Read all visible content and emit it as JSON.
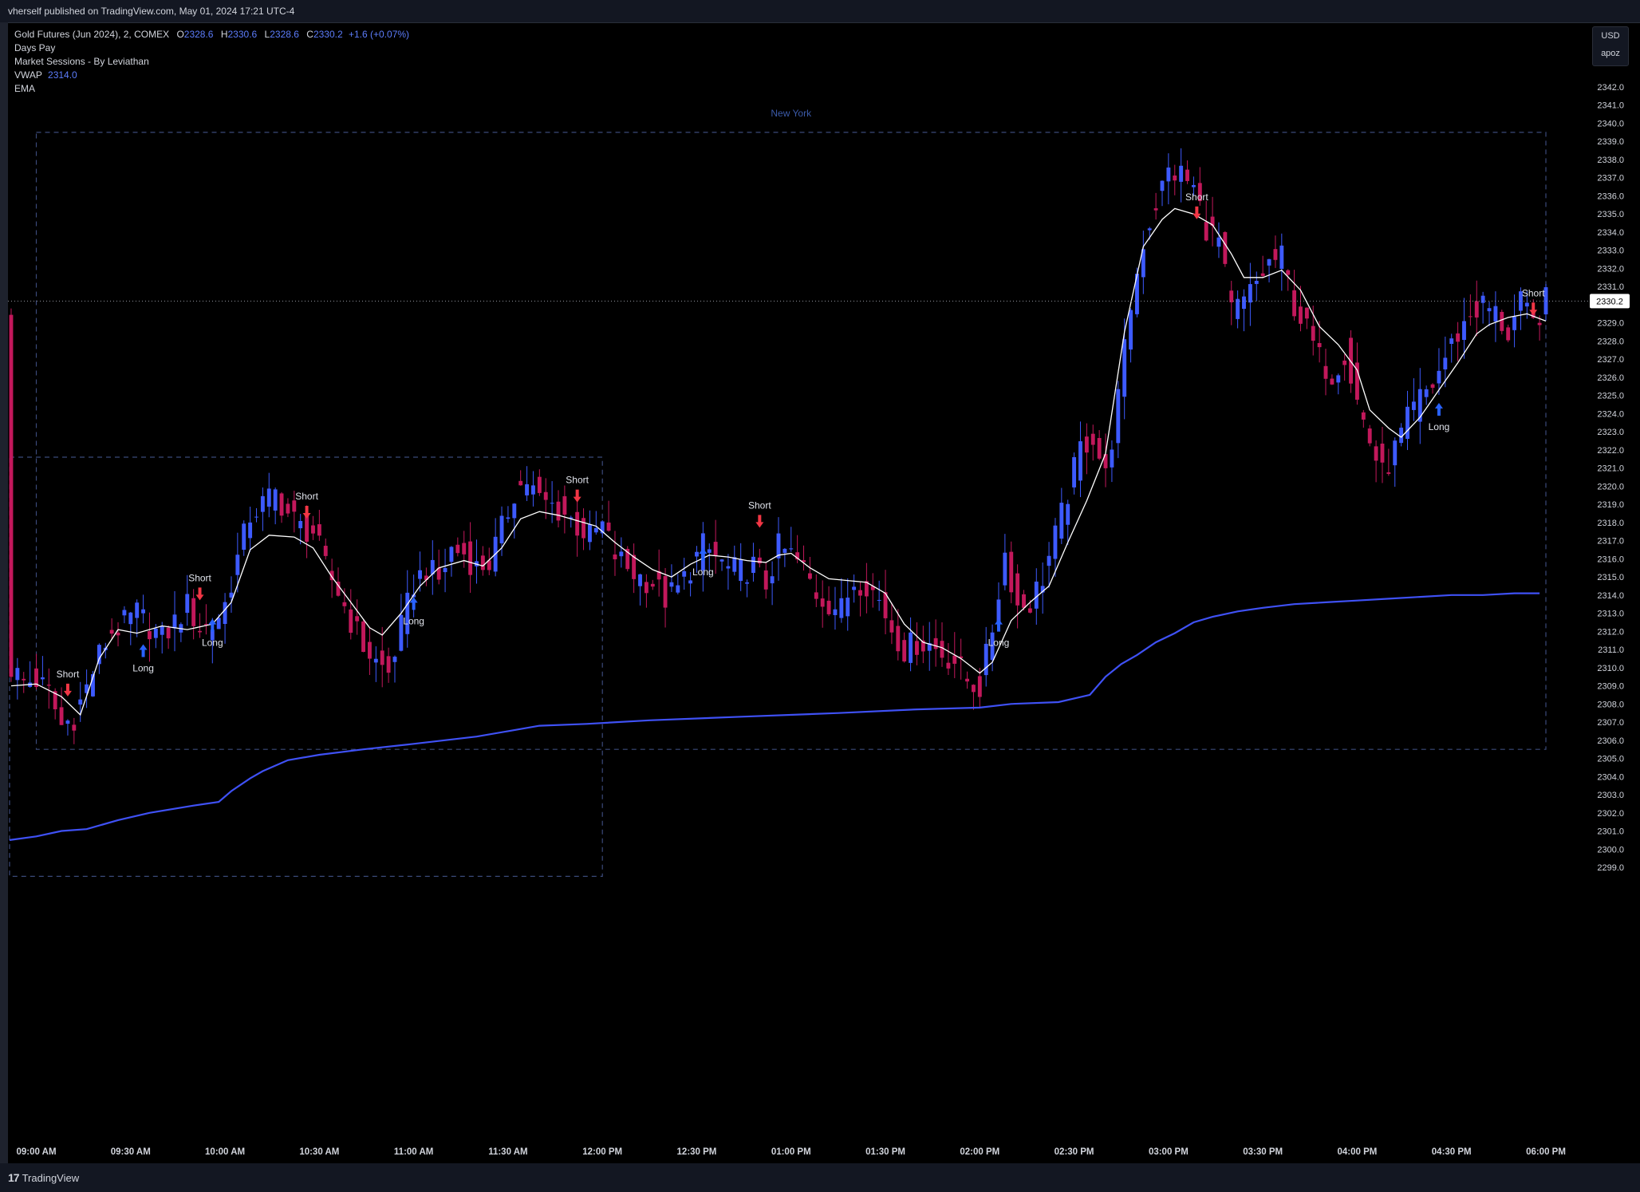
{
  "header": {
    "publish_note": "vherself published on TradingView.com, May 01, 2024 17:21 UTC-4"
  },
  "legend": {
    "symbol": "Gold Futures (Jun 2024), 2, COMEX",
    "open_label": "O",
    "open": "2328.6",
    "high_label": "H",
    "high": "2330.6",
    "low_label": "L",
    "low": "2328.6",
    "close_label": "C",
    "close": "2330.2",
    "change": "+1.6 (+0.07%)",
    "indicators": [
      {
        "name": "Days Pay",
        "value": ""
      },
      {
        "name": "Market Sessions - By Leviathan",
        "value": ""
      },
      {
        "name": "VWAP",
        "value": "2314.0"
      },
      {
        "name": "EMA",
        "value": ""
      }
    ]
  },
  "currency": {
    "code": "USD",
    "unit": "apoz"
  },
  "footer": {
    "brand": "TradingView",
    "brand_mark": "17"
  },
  "colors": {
    "background": "#000000",
    "up_candle": "#3d5afe",
    "down_candle": "#c2185b",
    "vwap": "#3f51f5",
    "ema": "#ffffff",
    "session_box": "#3b4a7a",
    "long_arrow": "#2962ff",
    "short_arrow": "#f23645",
    "axis_text": "#d1d4dc"
  },
  "chart_data": {
    "type": "candlestick",
    "symbol": "Gold Futures (Jun 2024), 2, COMEX",
    "ylim": [
      2298.5,
      2342.8
    ],
    "y_ticks": [
      2299.0,
      2300.0,
      2301.0,
      2302.0,
      2303.0,
      2304.0,
      2305.0,
      2306.0,
      2307.0,
      2308.0,
      2309.0,
      2310.0,
      2311.0,
      2312.0,
      2313.0,
      2314.0,
      2315.0,
      2316.0,
      2317.0,
      2318.0,
      2319.0,
      2320.0,
      2321.0,
      2322.0,
      2323.0,
      2324.0,
      2325.0,
      2326.0,
      2327.0,
      2328.0,
      2329.0,
      2330.0,
      2331.0,
      2332.0,
      2333.0,
      2334.0,
      2335.0,
      2336.0,
      2337.0,
      2338.0,
      2339.0,
      2340.0,
      2341.0,
      2342.0
    ],
    "y_tick_labels": [
      "2299.0",
      "2300.0",
      "2301.0",
      "2302.0",
      "2303.0",
      "2304.0",
      "2305.0",
      "2306.0",
      "2307.0",
      "2308.0",
      "2309.0",
      "2310.0",
      "2311.0",
      "2312.0",
      "2313.0",
      "2314.0",
      "2315.0",
      "2316.0",
      "2317.0",
      "2318.0",
      "2319.0",
      "2320.0",
      "2321.0",
      "2322.0",
      "2323.0",
      "2324.0",
      "2325.0",
      "2326.0",
      "2327.0",
      "2328.0",
      "2329.0",
      "2330.0",
      "2331.0",
      "2332.0",
      "2333.0",
      "2334.0",
      "2335.0",
      "2336.0",
      "2337.0",
      "2338.0",
      "2339.0",
      "2340.0",
      "2341.0",
      "2342.0"
    ],
    "x_labels": [
      {
        "label": "09:00 AM",
        "t": 0
      },
      {
        "label": "09:30 AM",
        "t": 30
      },
      {
        "label": "10:00 AM",
        "t": 60
      },
      {
        "label": "10:30 AM",
        "t": 90
      },
      {
        "label": "11:00 AM",
        "t": 120
      },
      {
        "label": "11:30 AM",
        "t": 150
      },
      {
        "label": "12:00 PM",
        "t": 180
      },
      {
        "label": "12:30 PM",
        "t": 210
      },
      {
        "label": "01:00 PM",
        "t": 240
      },
      {
        "label": "01:30 PM",
        "t": 270
      },
      {
        "label": "02:00 PM",
        "t": 300
      },
      {
        "label": "02:30 PM",
        "t": 330
      },
      {
        "label": "03:00 PM",
        "t": 360
      },
      {
        "label": "03:30 PM",
        "t": 390
      },
      {
        "label": "04:00 PM",
        "t": 420
      },
      {
        "label": "04:30 PM",
        "t": 450
      },
      {
        "label": "06:00 PM",
        "t": 480
      }
    ],
    "xlim_minutes": [
      -8.5,
      480
    ],
    "bar_interval_minutes": 2,
    "last_price": "2330.2",
    "last_price_value": 2330.2,
    "close_path": [
      [
        -8,
        2310
      ],
      [
        -4,
        2309.2
      ],
      [
        0,
        2309.3
      ],
      [
        4,
        2308.6
      ],
      [
        8,
        2306.8
      ],
      [
        12,
        2307.3
      ],
      [
        16,
        2308.9
      ],
      [
        20,
        2310.7
      ],
      [
        24,
        2312
      ],
      [
        28,
        2312.4
      ],
      [
        32,
        2313
      ],
      [
        36,
        2312.3
      ],
      [
        40,
        2311.6
      ],
      [
        44,
        2312.5
      ],
      [
        48,
        2313.4
      ],
      [
        52,
        2312.2
      ],
      [
        56,
        2312.3
      ],
      [
        60,
        2313.5
      ],
      [
        64,
        2316
      ],
      [
        68,
        2318.4
      ],
      [
        72,
        2319
      ],
      [
        76,
        2319.6
      ],
      [
        80,
        2318.5
      ],
      [
        84,
        2317.7
      ],
      [
        88,
        2317.5
      ],
      [
        92,
        2315.5
      ],
      [
        96,
        2314.2
      ],
      [
        100,
        2312.6
      ],
      [
        104,
        2311.2
      ],
      [
        108,
        2310.3
      ],
      [
        112,
        2309.7
      ],
      [
        116,
        2312.2
      ],
      [
        120,
        2314.6
      ],
      [
        124,
        2315.5
      ],
      [
        128,
        2314.8
      ],
      [
        132,
        2316.5
      ],
      [
        136,
        2316.3
      ],
      [
        140,
        2315.5
      ],
      [
        144,
        2315.8
      ],
      [
        148,
        2317.6
      ],
      [
        152,
        2319.7
      ],
      [
        156,
        2320.3
      ],
      [
        160,
        2319.2
      ],
      [
        164,
        2318.9
      ],
      [
        168,
        2318.5
      ],
      [
        172,
        2317.8
      ],
      [
        176,
        2317.2
      ],
      [
        180,
        2317.8
      ],
      [
        184,
        2316.2
      ],
      [
        188,
        2315.5
      ],
      [
        192,
        2315
      ],
      [
        196,
        2314.7
      ],
      [
        200,
        2313.8
      ],
      [
        204,
        2314.3
      ],
      [
        208,
        2315.5
      ],
      [
        212,
        2316.7
      ],
      [
        216,
        2316.1
      ],
      [
        220,
        2315.4
      ],
      [
        224,
        2315.3
      ],
      [
        228,
        2315.6
      ],
      [
        232,
        2314.6
      ],
      [
        236,
        2316.6
      ],
      [
        240,
        2316.2
      ],
      [
        244,
        2315.4
      ],
      [
        248,
        2314.1
      ],
      [
        252,
        2313.6
      ],
      [
        256,
        2313.2
      ],
      [
        260,
        2314.8
      ],
      [
        264,
        2314.7
      ],
      [
        268,
        2313.7
      ],
      [
        272,
        2312.2
      ],
      [
        276,
        2311
      ],
      [
        280,
        2311.4
      ],
      [
        284,
        2311.3
      ],
      [
        288,
        2310.8
      ],
      [
        292,
        2310.4
      ],
      [
        296,
        2309.3
      ],
      [
        300,
        2308.9
      ],
      [
        304,
        2312.2
      ],
      [
        308,
        2316.3
      ],
      [
        312,
        2313.4
      ],
      [
        316,
        2313.6
      ],
      [
        320,
        2315
      ],
      [
        324,
        2317.2
      ],
      [
        328,
        2319.6
      ],
      [
        332,
        2322.1
      ],
      [
        336,
        2322.8
      ],
      [
        340,
        2320.5
      ],
      [
        344,
        2324.8
      ],
      [
        348,
        2330
      ],
      [
        352,
        2333.5
      ],
      [
        356,
        2335.6
      ],
      [
        360,
        2337.3
      ],
      [
        364,
        2337.2
      ],
      [
        368,
        2336.4
      ],
      [
        372,
        2334.3
      ],
      [
        376,
        2333.5
      ],
      [
        380,
        2329.6
      ],
      [
        384,
        2330.1
      ],
      [
        388,
        2331.2
      ],
      [
        392,
        2332.3
      ],
      [
        396,
        2332.6
      ],
      [
        400,
        2330
      ],
      [
        404,
        2328.6
      ],
      [
        408,
        2327
      ],
      [
        412,
        2326.2
      ],
      [
        416,
        2327.4
      ],
      [
        420,
        2324.7
      ],
      [
        424,
        2322.5
      ],
      [
        428,
        2320.6
      ],
      [
        432,
        2322
      ],
      [
        436,
        2323.6
      ],
      [
        440,
        2324.8
      ],
      [
        444,
        2325.6
      ],
      [
        448,
        2327.1
      ],
      [
        452,
        2328.4
      ],
      [
        456,
        2329.5
      ],
      [
        460,
        2330
      ],
      [
        464,
        2329.5
      ],
      [
        468,
        2328.4
      ],
      [
        472,
        2330
      ],
      [
        476,
        2328.9
      ],
      [
        480,
        2330.2
      ]
    ],
    "ema_path": [
      [
        -8,
        2309
      ],
      [
        0,
        2309.1
      ],
      [
        8,
        2308.4
      ],
      [
        14,
        2307.4
      ],
      [
        20,
        2310.5
      ],
      [
        26,
        2312.1
      ],
      [
        32,
        2311.9
      ],
      [
        40,
        2312.3
      ],
      [
        48,
        2312.1
      ],
      [
        56,
        2312.4
      ],
      [
        62,
        2313.6
      ],
      [
        68,
        2316.5
      ],
      [
        74,
        2317.3
      ],
      [
        82,
        2317.2
      ],
      [
        88,
        2316.6
      ],
      [
        94,
        2315
      ],
      [
        100,
        2313.6
      ],
      [
        106,
        2312.2
      ],
      [
        110,
        2311.8
      ],
      [
        116,
        2313
      ],
      [
        122,
        2314.5
      ],
      [
        128,
        2315.5
      ],
      [
        136,
        2315.9
      ],
      [
        142,
        2315.6
      ],
      [
        148,
        2316.6
      ],
      [
        154,
        2318.2
      ],
      [
        160,
        2318.6
      ],
      [
        166,
        2318.4
      ],
      [
        172,
        2318.1
      ],
      [
        178,
        2317.8
      ],
      [
        184,
        2316.9
      ],
      [
        190,
        2316.1
      ],
      [
        196,
        2315.4
      ],
      [
        202,
        2315
      ],
      [
        208,
        2315.7
      ],
      [
        214,
        2316.2
      ],
      [
        220,
        2316.1
      ],
      [
        226,
        2315.9
      ],
      [
        232,
        2315.8
      ],
      [
        236,
        2316.2
      ],
      [
        240,
        2316.3
      ],
      [
        246,
        2315.5
      ],
      [
        252,
        2314.9
      ],
      [
        258,
        2314.8
      ],
      [
        264,
        2314.7
      ],
      [
        270,
        2314.1
      ],
      [
        276,
        2312.4
      ],
      [
        282,
        2311.4
      ],
      [
        288,
        2311.1
      ],
      [
        294,
        2310.5
      ],
      [
        300,
        2309.7
      ],
      [
        304,
        2310.3
      ],
      [
        310,
        2312.6
      ],
      [
        316,
        2313.6
      ],
      [
        322,
        2314.5
      ],
      [
        328,
        2316.9
      ],
      [
        334,
        2319.2
      ],
      [
        340,
        2321.8
      ],
      [
        346,
        2328.5
      ],
      [
        352,
        2333.2
      ],
      [
        358,
        2334.7
      ],
      [
        362,
        2335.3
      ],
      [
        368,
        2335
      ],
      [
        374,
        2334.4
      ],
      [
        380,
        2332.8
      ],
      [
        384,
        2331.5
      ],
      [
        390,
        2331.5
      ],
      [
        396,
        2331.9
      ],
      [
        402,
        2330.8
      ],
      [
        408,
        2328.8
      ],
      [
        414,
        2327.8
      ],
      [
        420,
        2326.4
      ],
      [
        424,
        2324.2
      ],
      [
        430,
        2323.2
      ],
      [
        434,
        2322.7
      ],
      [
        440,
        2323.8
      ],
      [
        446,
        2325.3
      ],
      [
        452,
        2326.8
      ],
      [
        458,
        2328.4
      ],
      [
        462,
        2328.9
      ],
      [
        468,
        2329.3
      ],
      [
        474,
        2329.5
      ],
      [
        480,
        2329.1
      ]
    ],
    "vwap_path": [
      [
        -8.5,
        2300.5
      ],
      [
        0,
        2300.7
      ],
      [
        8,
        2301
      ],
      [
        16,
        2301.1
      ],
      [
        26,
        2301.6
      ],
      [
        36,
        2302
      ],
      [
        50,
        2302.4
      ],
      [
        58,
        2302.6
      ],
      [
        62,
        2303.2
      ],
      [
        68,
        2303.9
      ],
      [
        72,
        2304.3
      ],
      [
        80,
        2304.9
      ],
      [
        90,
        2305.2
      ],
      [
        104,
        2305.5
      ],
      [
        120,
        2305.8
      ],
      [
        140,
        2306.2
      ],
      [
        150,
        2306.5
      ],
      [
        160,
        2306.8
      ],
      [
        175,
        2306.9
      ],
      [
        195,
        2307.1
      ],
      [
        225,
        2307.3
      ],
      [
        255,
        2307.5
      ],
      [
        280,
        2307.7
      ],
      [
        300,
        2307.8
      ],
      [
        310,
        2308
      ],
      [
        325,
        2308.1
      ],
      [
        335,
        2308.5
      ],
      [
        340,
        2309.5
      ],
      [
        345,
        2310.2
      ],
      [
        350,
        2310.7
      ],
      [
        356,
        2311.4
      ],
      [
        362,
        2311.9
      ],
      [
        368,
        2312.5
      ],
      [
        374,
        2312.8
      ],
      [
        382,
        2313.1
      ],
      [
        390,
        2313.3
      ],
      [
        400,
        2313.5
      ],
      [
        410,
        2313.6
      ],
      [
        420,
        2313.7
      ],
      [
        430,
        2313.8
      ],
      [
        440,
        2313.9
      ],
      [
        450,
        2314
      ],
      [
        460,
        2314
      ],
      [
        470,
        2314.1
      ],
      [
        478,
        2314.1
      ]
    ],
    "signals": [
      {
        "label": "Short",
        "t": 10,
        "price": 2308.5,
        "type": "short"
      },
      {
        "label": "Long",
        "t": 34,
        "price": 2311.2,
        "type": "long"
      },
      {
        "label": "Short",
        "t": 52,
        "price": 2313.8,
        "type": "short"
      },
      {
        "label": "Long",
        "t": 56,
        "price": 2312.6,
        "type": "long"
      },
      {
        "label": "Short",
        "t": 86,
        "price": 2318.3,
        "type": "short"
      },
      {
        "label": "Long",
        "t": 120,
        "price": 2313.8,
        "type": "long"
      },
      {
        "label": "Short",
        "t": 172,
        "price": 2319.2,
        "type": "short"
      },
      {
        "label": "Long",
        "t": 212,
        "price": 2316.5,
        "type": "long"
      },
      {
        "label": "Short",
        "t": 230,
        "price": 2317.8,
        "type": "short"
      },
      {
        "label": "Long",
        "t": 306,
        "price": 2312.6,
        "type": "long"
      },
      {
        "label": "Short",
        "t": 369,
        "price": 2334.8,
        "type": "short"
      },
      {
        "label": "Long",
        "t": 446,
        "price": 2324.5,
        "type": "long"
      },
      {
        "label": "Short",
        "t": 476,
        "price": 2329.5,
        "type": "short"
      }
    ],
    "sessions": [
      {
        "label": "",
        "t0": -8.5,
        "t1": 180,
        "high": 2321.6,
        "low": 2298.5
      },
      {
        "label": "New York",
        "t0": 0,
        "t1": 480,
        "high": 2339.5,
        "low": 2305.5
      }
    ],
    "grid": false,
    "legend_position": "top-left"
  }
}
